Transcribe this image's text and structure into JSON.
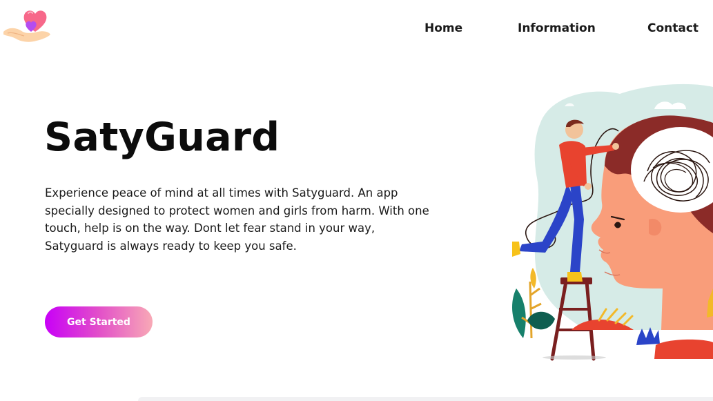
{
  "nav": {
    "home": "Home",
    "information": "Information",
    "contact": "Contact"
  },
  "hero": {
    "title": "SatyGuard",
    "description": "Experience peace of mind at all times with Satyguard. An app specially designed to protect women and girls from harm. With one touch, help is on the way. Dont let fear stand in your way, Satyguard is always ready to keep you safe.",
    "cta_label": "Get Started"
  },
  "icons": {
    "logo": "heart-in-hand-icon",
    "illustration": "tangled-thoughts-illustration"
  },
  "colors": {
    "cta_gradient_start": "#c800f7",
    "cta_gradient_end": "#f8a9b6",
    "text": "#111111",
    "background": "#ffffff"
  }
}
